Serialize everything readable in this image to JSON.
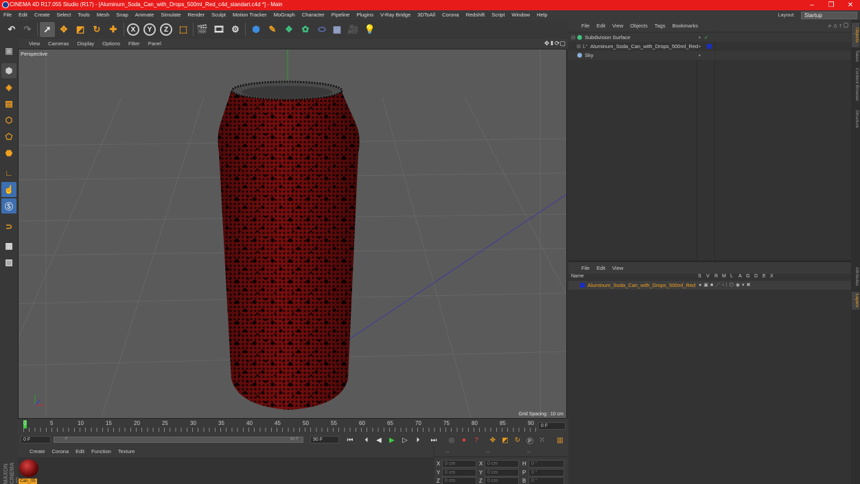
{
  "window": {
    "title": "CINEMA 4D R17.055 Studio (R17) - [Aluminum_Soda_Can_with_Drops_500ml_Red_c4d_standart.c4d *] - Main"
  },
  "menu": [
    "File",
    "Edit",
    "Create",
    "Select",
    "Tools",
    "Mesh",
    "Snap",
    "Animate",
    "Simulate",
    "Render",
    "Sculpt",
    "Motion Tracker",
    "MoGraph",
    "Character",
    "Pipeline",
    "Plugins",
    "V-Ray Bridge",
    "3DToAll",
    "Corona",
    "Redshift",
    "Script",
    "Window",
    "Help"
  ],
  "layout": {
    "label": "Layout:",
    "value": "Startup"
  },
  "toolbar_axes": [
    "X",
    "Y",
    "Z"
  ],
  "viewport": {
    "menu": [
      "View",
      "Cameras",
      "Display",
      "Options",
      "Filter",
      "Panel"
    ],
    "label": "Perspective",
    "grid_spacing": "Grid Spacing : 10 cm"
  },
  "timeline": {
    "ticks": [
      "0",
      "5",
      "10",
      "15",
      "20",
      "25",
      "30",
      "35",
      "40",
      "45",
      "50",
      "55",
      "60",
      "65",
      "70",
      "75",
      "80",
      "85",
      "90"
    ],
    "end_field": "0 F"
  },
  "transport": {
    "start": "0 F",
    "slider_start": "F",
    "slider_end": "90 F",
    "end": "90 F"
  },
  "material_panel": {
    "menu": [
      "Create",
      "Corona",
      "Edit",
      "Function",
      "Texture"
    ],
    "material_name": "Can_05"
  },
  "coordinates": {
    "headers": [
      "--",
      "--",
      "--"
    ],
    "rows": [
      {
        "a": "X",
        "av": "0 cm",
        "b": "X",
        "bv": "0 cm",
        "c": "H",
        "cv": "0 °"
      },
      {
        "a": "Y",
        "av": "0 cm",
        "b": "Y",
        "bv": "0 cm",
        "c": "P",
        "cv": "0 °"
      },
      {
        "a": "Z",
        "av": "0 cm",
        "b": "Z",
        "bv": "0 cm",
        "c": "B",
        "cv": "0 °"
      }
    ]
  },
  "object_manager": {
    "menu": [
      "File",
      "Edit",
      "View",
      "Objects",
      "Tags",
      "Bookmarks"
    ],
    "objects": [
      {
        "name": "Subdivision Surface",
        "color": "#5ec85e"
      },
      {
        "name": "Aluminum_Soda_Can_with_Drops_500ml_Red",
        "color": "#cfcfcf"
      },
      {
        "name": "Sky",
        "color": "#cfcfcf"
      }
    ]
  },
  "attribute_manager": {
    "menu": [
      "File",
      "Edit",
      "View"
    ],
    "columns": {
      "name": "Name",
      "flags": [
        "S",
        "V",
        "R",
        "M",
        "L",
        "A",
        "G",
        "D",
        "E",
        "X"
      ]
    },
    "row": {
      "name": "Aluminum_Soda_Can_with_Drops_500ml_Red",
      "color": "#f0a020"
    }
  },
  "side_tabs": [
    "Objects",
    "Takes",
    "Content Browser",
    "Structure",
    "Attributes",
    "Layers"
  ],
  "brand_vertical": "MAXON CINEMA 4D",
  "colors": {
    "title_bar": "#e81b1b",
    "accent_orange": "#f0a020",
    "can_red": "#8a1010",
    "tool_blue": "#3d8de0"
  }
}
